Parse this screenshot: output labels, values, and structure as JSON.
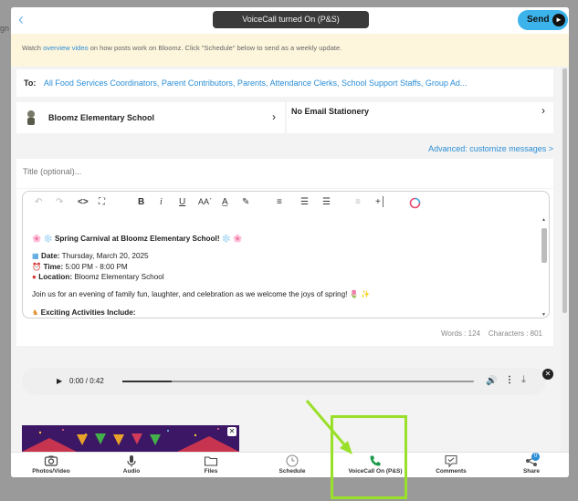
{
  "backdrop": {
    "left_text": "gn"
  },
  "header": {
    "back_icon": "chevron-left-icon",
    "toast": "VoiceCall turned On (P&S)",
    "send_label": "Send"
  },
  "info": {
    "prefix": "Watch ",
    "link": "overview video",
    "suffix": " on how posts work on Bloomz. Click \"Schedule\" below to send as a weekly update."
  },
  "recipients": {
    "label": "To:",
    "value": "All Food Services Coordinators, Parent Contributors, Parents, Attendance Clerks, School Support Staffs, Group Ad..."
  },
  "school": {
    "name": "Bloomz Elementary School"
  },
  "stationery": {
    "label": "No Email Stationery"
  },
  "advanced": {
    "label": "Advanced: customize messages >"
  },
  "title_field": {
    "placeholder": "Title (optional)..."
  },
  "editor": {
    "toolbar": [
      "undo-icon",
      "redo-icon",
      "code-icon",
      "fullscreen-icon",
      "bold-icon",
      "italic-icon",
      "underline-icon",
      "font-size-icon",
      "text-color-icon",
      "highlight-icon",
      "align-icon",
      "numbered-list-icon",
      "bullet-list-icon",
      "indent-icon",
      "insert-icon",
      "color-picker-icon"
    ],
    "heading": "🌸 ❄️ Spring Carnival at Bloomz Elementary School! ❄️ 🌸",
    "date_label": "Date:",
    "date_value": " Thursday, March 20, 2025",
    "time_label": "Time:",
    "time_value": " 5:00 PM - 8:00 PM",
    "location_label": "Location:",
    "location_value": " Bloomz Elementary School",
    "intro": "Join us for an evening of family fun, laughter, and celebration as we welcome the joys of spring! 🌷 ✨",
    "activities": "Exciting Activities Include:",
    "words": "Words : 124",
    "characters": "Characters : 801"
  },
  "audio": {
    "time": "0:00 / 0:42",
    "progress": 0.14
  },
  "bottom_bar": {
    "items": [
      {
        "label": "Photos/Video",
        "icon": "camera-icon"
      },
      {
        "label": "Audio",
        "icon": "microphone-icon"
      },
      {
        "label": "Files",
        "icon": "folder-icon"
      },
      {
        "label": "Schedule",
        "icon": "clock-icon"
      },
      {
        "label": "VoiceCall On (P&S)",
        "icon": "phone-icon"
      },
      {
        "label": "Comments",
        "icon": "comment-icon"
      },
      {
        "label": "Share",
        "icon": "share-icon"
      }
    ],
    "share_badge": "0"
  },
  "colors": {
    "accent": "#2b8ed6",
    "send": "#3cb3ea",
    "highlight": "#9ae02a",
    "phone": "#1a9a4a"
  }
}
